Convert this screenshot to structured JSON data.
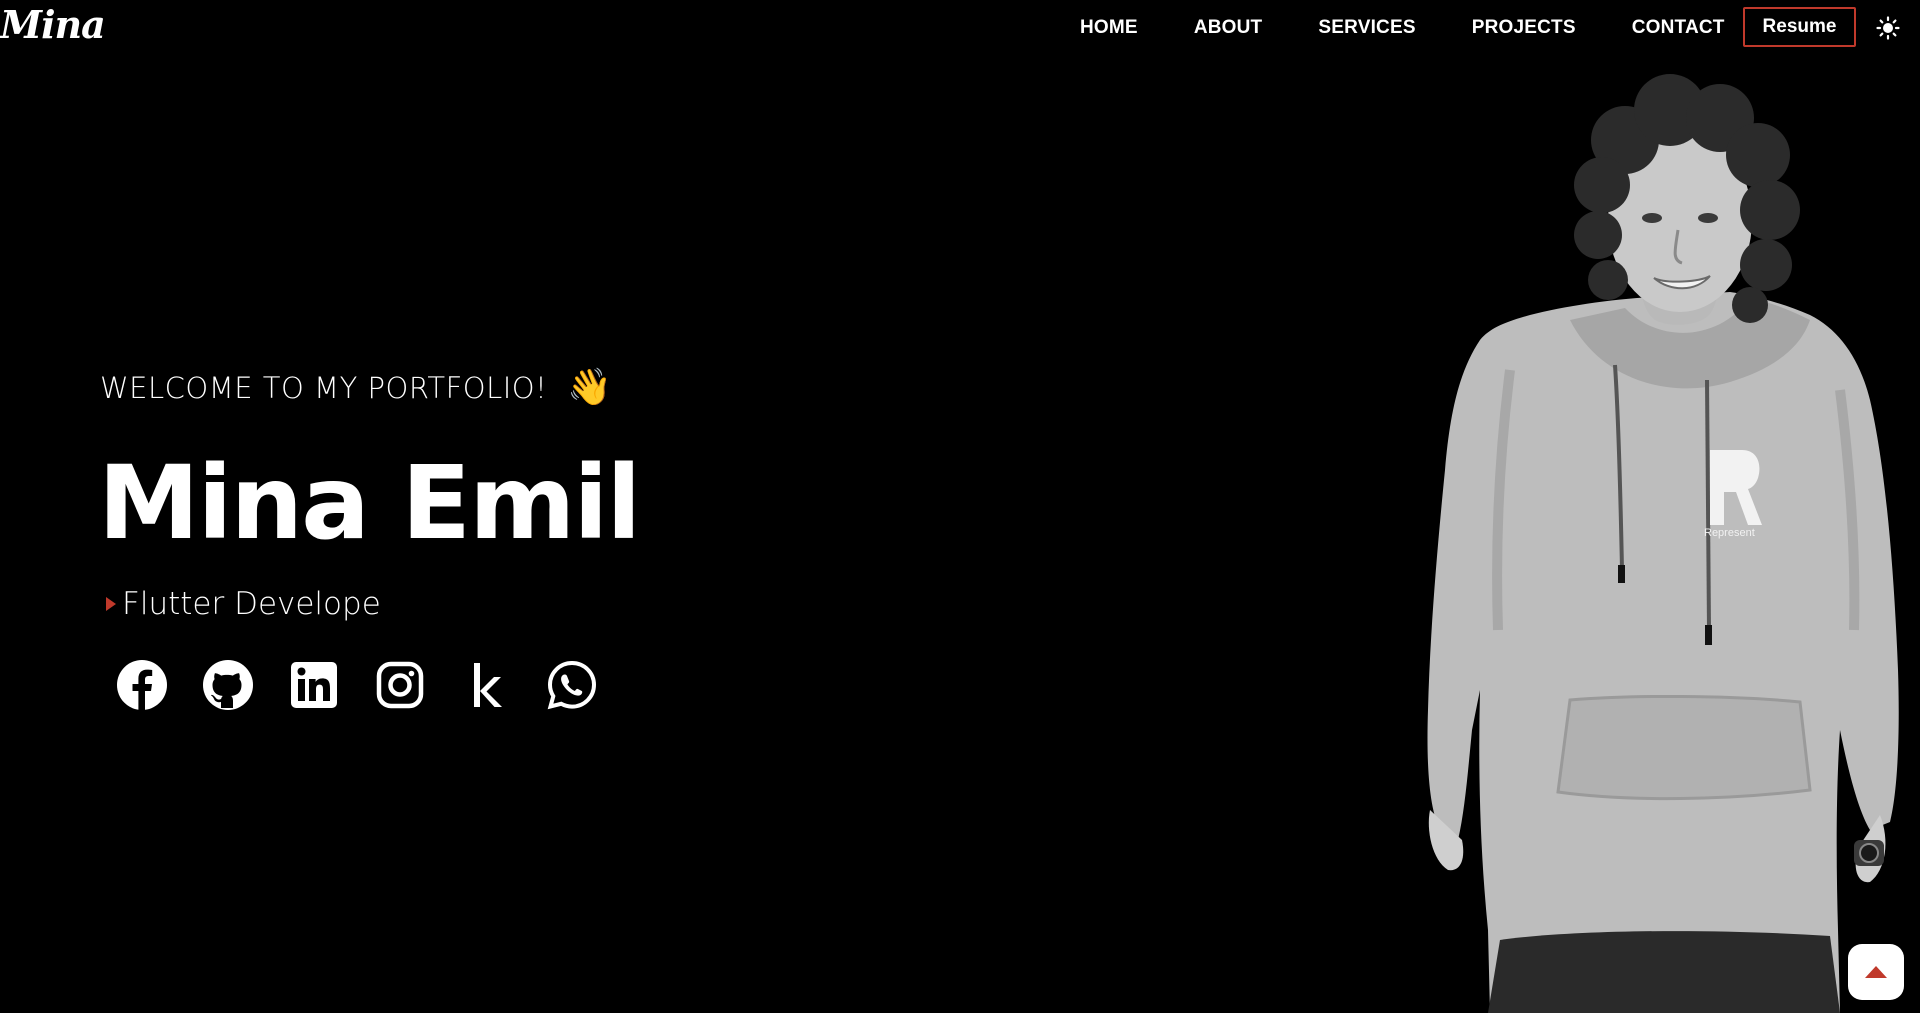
{
  "navbar": {
    "logo_text": "Mina",
    "links": [
      {
        "label": "HOME"
      },
      {
        "label": "ABOUT"
      },
      {
        "label": "SERVICES"
      },
      {
        "label": "PROJECTS"
      },
      {
        "label": "CONTACT"
      }
    ],
    "resume_label": "Resume",
    "theme_toggle_icon": "sun-icon"
  },
  "hero": {
    "welcome_text": "WELCOME TO MY PORTFOLIO!",
    "wave_emoji": "👋",
    "name": "Mina Emil",
    "role_text": "Flutter Develope",
    "socials": [
      {
        "icon": "facebook-icon"
      },
      {
        "icon": "github-icon"
      },
      {
        "icon": "linkedin-icon"
      },
      {
        "icon": "instagram-icon"
      },
      {
        "icon": "kaggle-icon",
        "glyph": "k"
      },
      {
        "icon": "whatsapp-icon"
      }
    ],
    "portrait_hoodie_text": "Represent"
  },
  "scroll_top": {
    "icon": "arrow-up-icon"
  },
  "colors": {
    "background": "#000000",
    "text": "#ffffff",
    "accent": "#c0392b"
  }
}
